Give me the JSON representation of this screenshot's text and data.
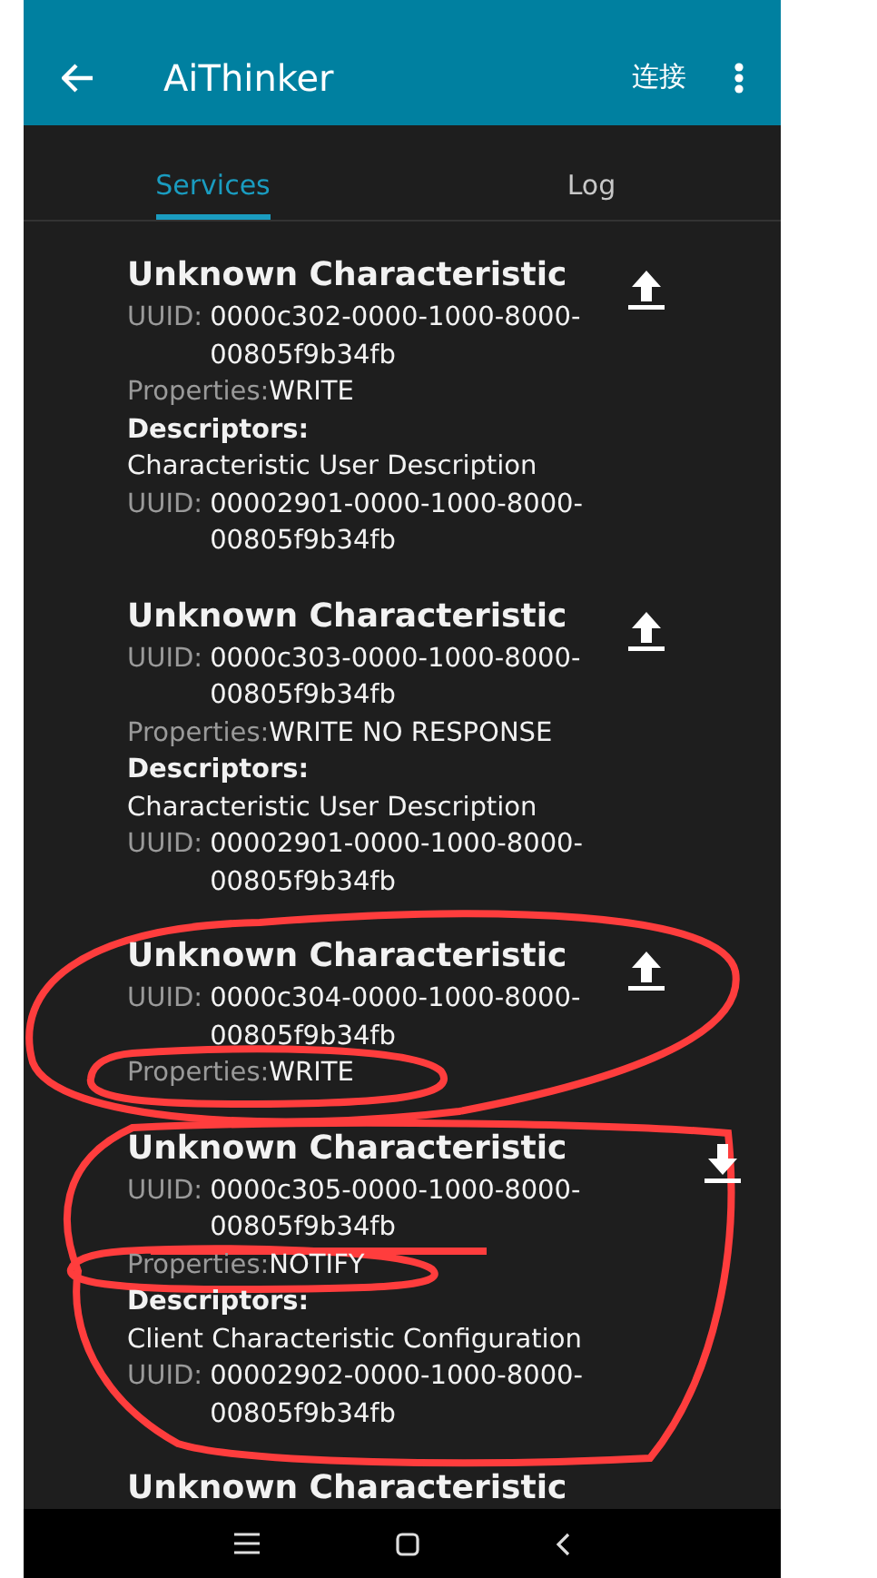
{
  "toolbar": {
    "title": "AiThinker",
    "action": "连接"
  },
  "tabs": [
    {
      "label": "Services",
      "selected": true
    },
    {
      "label": "Log",
      "selected": false
    }
  ],
  "characteristics": [
    {
      "name": "Unknown Characteristic",
      "uuid_label": "UUID:",
      "uuid": "0000c302-0000-1000-8000-00805f9b34fb",
      "properties_label": "Properties:",
      "properties": "WRITE",
      "kind": "upload",
      "descriptors_label": "Descriptors:",
      "descriptors": [
        {
          "name": "Characteristic User Description",
          "uuid_label": "UUID:",
          "uuid": "00002901-0000-1000-8000-00805f9b34fb"
        }
      ]
    },
    {
      "name": "Unknown Characteristic",
      "uuid_label": "UUID:",
      "uuid": "0000c303-0000-1000-8000-00805f9b34fb",
      "properties_label": "Properties:",
      "properties": "WRITE NO RESPONSE",
      "kind": "upload",
      "descriptors_label": "Descriptors:",
      "descriptors": [
        {
          "name": "Characteristic User Description",
          "uuid_label": "UUID:",
          "uuid": "00002901-0000-1000-8000-00805f9b34fb"
        }
      ]
    },
    {
      "name": "Unknown Characteristic",
      "uuid_label": "UUID:",
      "uuid": "0000c304-0000-1000-8000-00805f9b34fb",
      "properties_label": "Properties:",
      "properties": "WRITE",
      "kind": "upload"
    },
    {
      "name": "Unknown Characteristic",
      "uuid_label": "UUID:",
      "uuid": "0000c305-0000-1000-8000-00805f9b34fb",
      "properties_label": "Properties:",
      "properties": "NOTIFY",
      "kind": "download",
      "descriptors_label": "Descriptors:",
      "descriptors": [
        {
          "name": "Client Characteristic Configuration",
          "uuid_label": "UUID:",
          "uuid": "00002902-0000-1000-8000-00805f9b34fb"
        }
      ]
    },
    {
      "name": "Unknown Characteristic"
    }
  ]
}
